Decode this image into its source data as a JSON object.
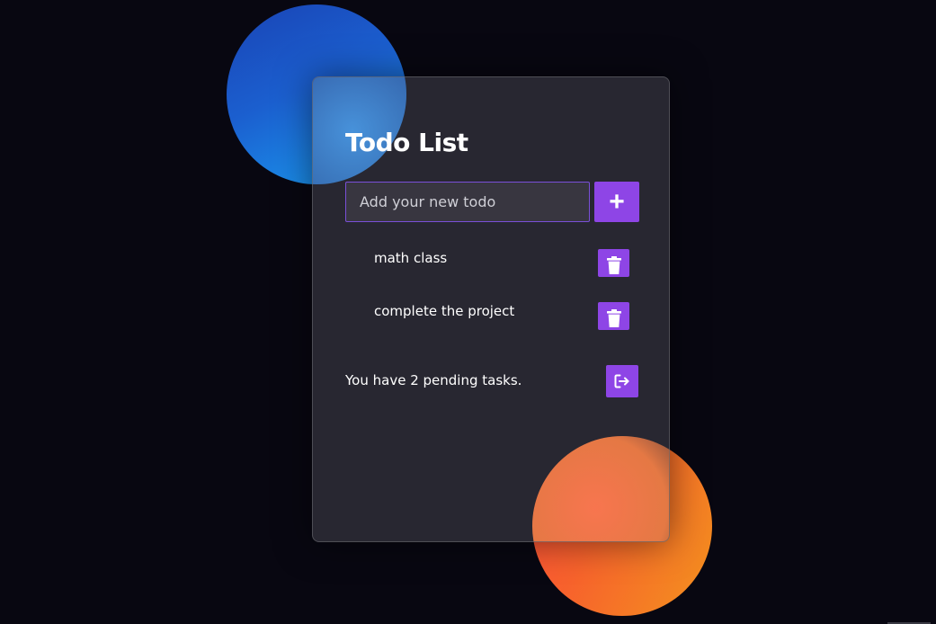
{
  "app": {
    "title": "Todo List"
  },
  "input": {
    "placeholder": "Add your new todo",
    "value": ""
  },
  "add_button": {
    "label": "+",
    "icon": "plus-icon"
  },
  "todos": [
    {
      "text": "math class",
      "delete_icon": "trash-icon"
    },
    {
      "text": "complete the project",
      "delete_icon": "trash-icon"
    }
  ],
  "footer": {
    "pending_text": "You have 2 pending tasks.",
    "logout_icon": "logout-icon"
  },
  "colors": {
    "accent": "#8e45e6",
    "background": "#080711",
    "card": "#2a2a31",
    "orb_blue": "#1a7fe8",
    "orb_orange": "#f7622c"
  }
}
